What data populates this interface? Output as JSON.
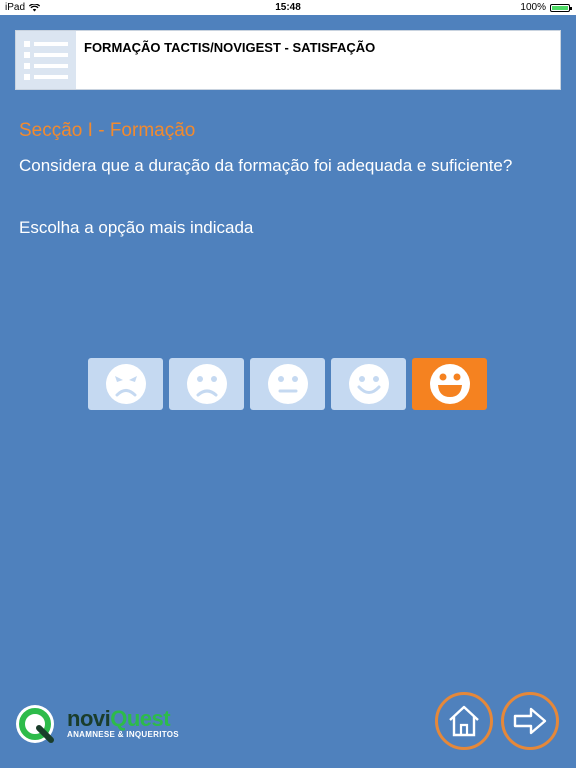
{
  "status_bar": {
    "device": "iPad",
    "time": "15:48",
    "battery": "100%"
  },
  "header": {
    "title": "FORMAÇÃO TACTIS/NOVIGEST - SATISFAÇÃO"
  },
  "section": {
    "title": "Secção I - Formação"
  },
  "question": {
    "text": "Considera que a duração da formação foi adequada e suficiente?"
  },
  "instruction": {
    "text": "Escolha a opção mais indicada"
  },
  "rating": {
    "options": [
      "angry-face-icon",
      "sad-face-icon",
      "neutral-face-icon",
      "smile-face-icon",
      "grin-face-icon"
    ],
    "selected_index": 4,
    "selected_color": "#f58220",
    "unselected_color": "#c5d9f1"
  },
  "logo": {
    "name_part1": "novi",
    "name_part2": "Quest",
    "subtitle": "ANAMNESE & INQUERITOS"
  },
  "nav": {
    "home_icon": "home-icon",
    "next_icon": "arrow-right-icon"
  },
  "colors": {
    "background": "#4f81bd",
    "accent": "#f28a2e",
    "ring": "#e5883a"
  }
}
